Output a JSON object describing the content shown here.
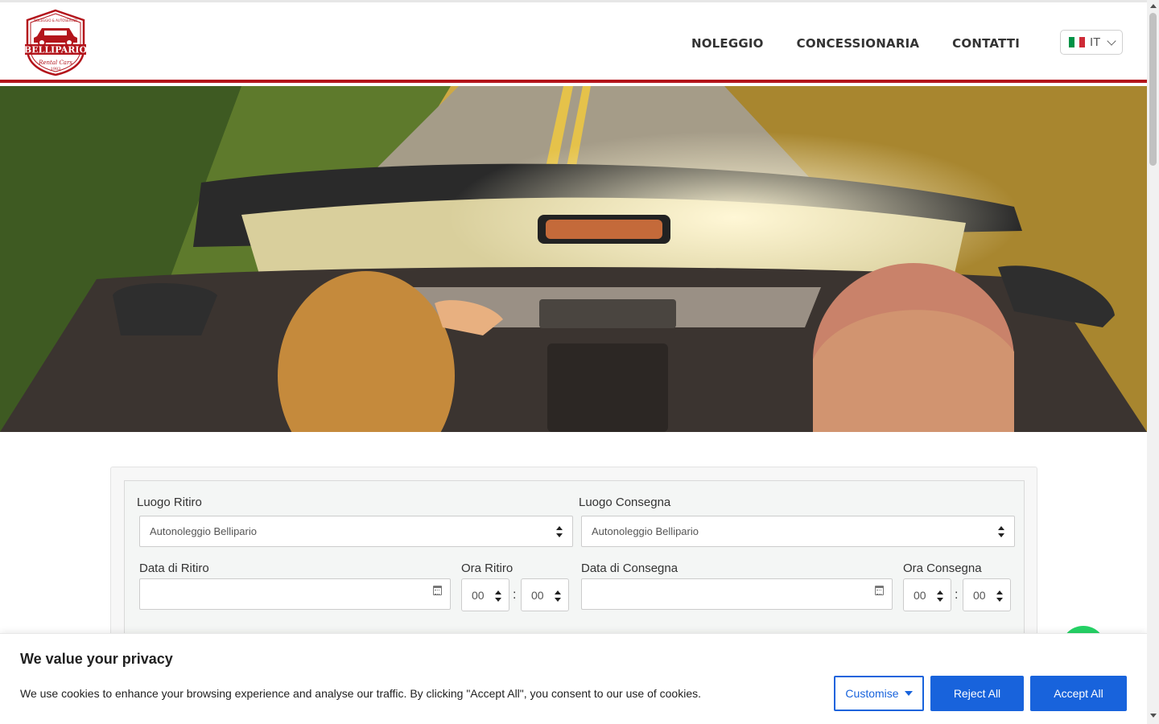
{
  "header": {
    "logo": {
      "brand": "BELLIPARIO",
      "top_text": "NOLEGGIO & AUTOSERVIZI",
      "script": "Rental Cars",
      "year": "1983",
      "color": "#b3141b"
    },
    "nav": [
      {
        "label": "NOLEGGIO"
      },
      {
        "label": "CONCESSIONARIA"
      },
      {
        "label": "CONTATTI"
      }
    ],
    "language": {
      "code": "IT",
      "flag_colors": [
        "#009246",
        "#ffffff",
        "#ce2b37"
      ]
    }
  },
  "hero": {
    "description_icon": "convertible-car-road-photo"
  },
  "booking": {
    "pickup_location": {
      "label": "Luogo Ritiro",
      "value": "Autonoleggio Bellipario"
    },
    "return_location": {
      "label": "Luogo Consegna",
      "value": "Autonoleggio Bellipario"
    },
    "pickup_date": {
      "label": "Data di Ritiro",
      "value": ""
    },
    "pickup_time": {
      "label": "Ora Ritiro",
      "hour": "00",
      "minute": "00"
    },
    "return_date": {
      "label": "Data di Consegna",
      "value": ""
    },
    "return_time": {
      "label": "Ora Consegna",
      "hour": "00",
      "minute": "00"
    },
    "separator": ":"
  },
  "cookie": {
    "title": "We value your privacy",
    "text": "We use cookies to enhance your browsing experience and analyse our traffic. By clicking \"Accept All\", you consent to our use of cookies.",
    "customise": "Customise",
    "reject": "Reject All",
    "accept": "Accept All",
    "accent": "#1863dc"
  }
}
